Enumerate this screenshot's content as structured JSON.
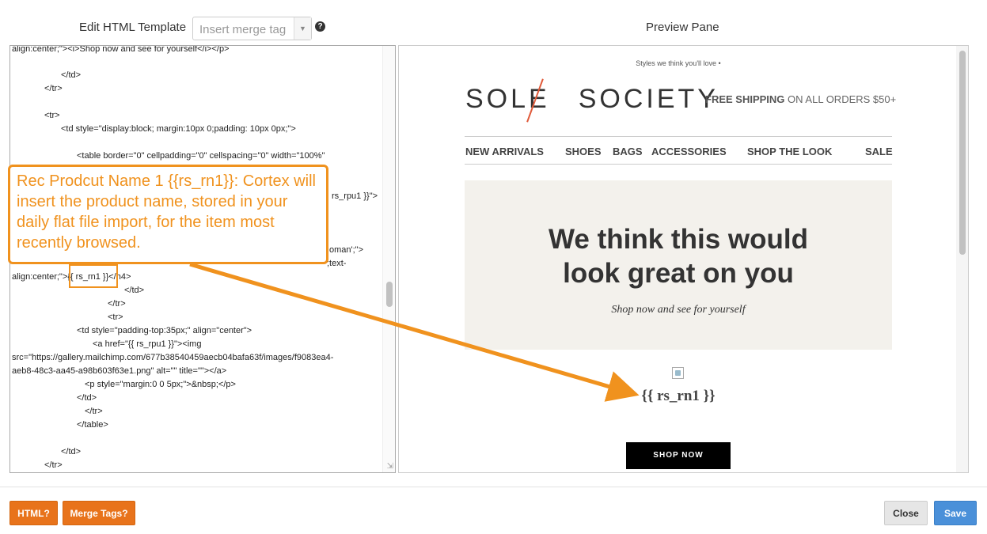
{
  "header": {
    "editor_title": "Edit HTML Template",
    "merge_placeholder": "Insert merge tag",
    "help_glyph": "?",
    "preview_title": "Preview Pane"
  },
  "code_lines": [
    "align:center;\"><i>Shop now and see for yourself</i></p>",
    "</td>",
    "</tr>",
    "<tr>",
    "<td style=\"display:block; margin:10px 0;padding: 10px 0px;\">",
    "<table border=\"0\" cellpadding=\"0\" cellspacing=\"0\" width=\"100%\"",
    "rs_rpu1 }}\">",
    "oman';\">",
    "align:center;\">{{ rs_rn1 }}</h4>",
    "</td>",
    "</tr>",
    "<tr>",
    "<td style=\"padding-top:35px;\" align=\"center\">",
    "<a href=\"{{ rs_rpu1 }}\"><img",
    "src=\"https://gallery.mailchimp.com/677b38540459aecb04bafa63f/images/f9083ea4-",
    "aeb8-48c3-aa45-a98b603f63e1.png\" alt=\"\" title=\"\"></a>",
    "<p style=\"margin:0 0 5px;\">&nbsp;</p>",
    "</td>",
    "</tr>",
    "</table>",
    "</td>",
    "</tr>"
  ],
  "extra_code": {
    "text_fragment": ";text-"
  },
  "callout": {
    "text": "Rec Prodcut Name 1 {{rs_rn1}}: Cortex will insert the product name, stored in your daily flat file import, for the item most recently browsed."
  },
  "preview": {
    "tagline": "Styles we think you'll love •",
    "logo_left": "SOLE",
    "logo_right": "SOCIETY",
    "shipping_bold": "FREE SHIPPING",
    "shipping_rest": " ON ALL ORDERS $50+",
    "nav": [
      "NEW ARRIVALS",
      "SHOES",
      "BAGS",
      "ACCESSORIES",
      "SHOP THE LOOK",
      "SALE"
    ],
    "hero_line1": "We think this would",
    "hero_line2": "look great on you",
    "hero_sub": "Shop now and see for yourself",
    "product_name": "{{ rs_rn1 }}",
    "shop_button": "SHOP NOW",
    "accent_color": "#e05a3a"
  },
  "footer": {
    "html_help": "HTML?",
    "merge_help": "Merge Tags?",
    "close": "Close",
    "save": "Save"
  },
  "colors": {
    "callout": "#f0921e",
    "orange_button": "#e8731b",
    "save_button": "#4a90d9"
  }
}
